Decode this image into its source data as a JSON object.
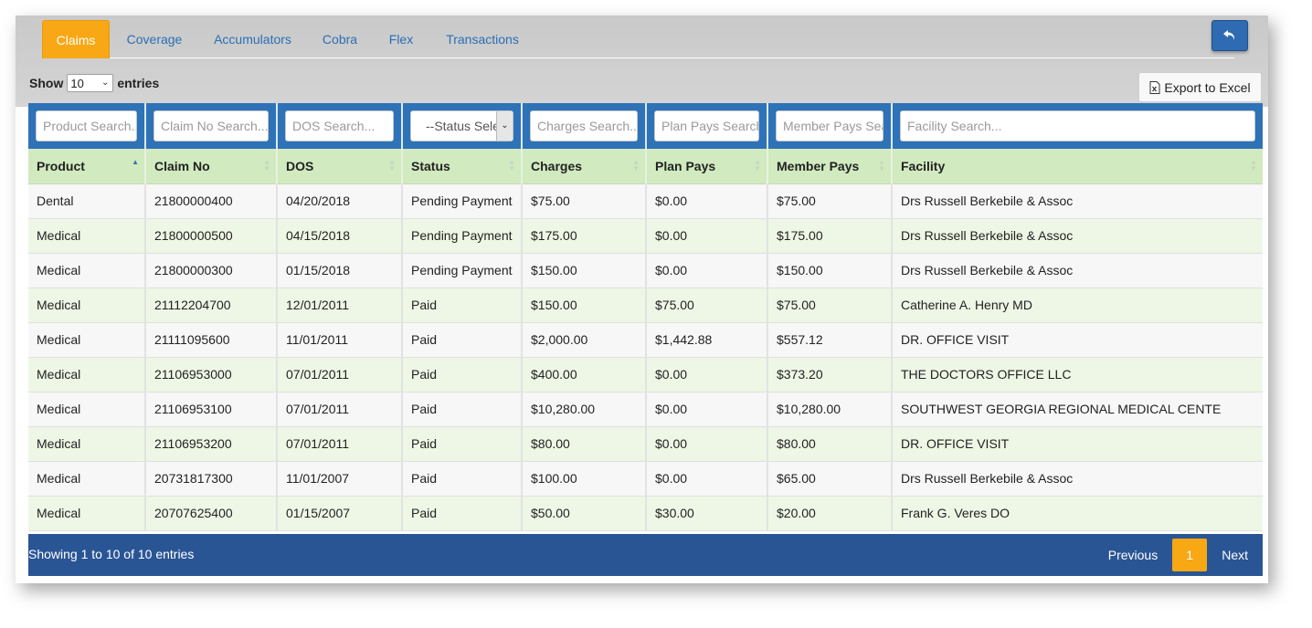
{
  "tabs": [
    {
      "label": "Claims",
      "active": true
    },
    {
      "label": "Coverage"
    },
    {
      "label": "Accumulators"
    },
    {
      "label": "Cobra"
    },
    {
      "label": "Flex"
    },
    {
      "label": "Transactions"
    }
  ],
  "back_button": {
    "icon": "undo-arrow-icon"
  },
  "length": {
    "show": "Show",
    "value": "10",
    "entries": "entries"
  },
  "export": {
    "label": "Export to Excel",
    "icon": "excel-file-icon"
  },
  "filters": {
    "product": "Product Search...",
    "claim_no": "Claim No Search...",
    "dos": "DOS Search...",
    "status": "--Status Select--",
    "charges": "Charges Search...",
    "plan_pays": "Plan Pays Search...",
    "member_pays": "Member Pays Search...",
    "facility": "Facility Search..."
  },
  "columns": [
    "Product",
    "Claim No",
    "DOS",
    "Status",
    "Charges",
    "Plan Pays",
    "Member Pays",
    "Facility"
  ],
  "rows": [
    [
      "Dental",
      "21800000400",
      "04/20/2018",
      "Pending Payment",
      "$75.00",
      "$0.00",
      "$75.00",
      "Drs Russell Berkebile & Assoc"
    ],
    [
      "Medical",
      "21800000500",
      "04/15/2018",
      "Pending Payment",
      "$175.00",
      "$0.00",
      "$175.00",
      "Drs Russell Berkebile & Assoc"
    ],
    [
      "Medical",
      "21800000300",
      "01/15/2018",
      "Pending Payment",
      "$150.00",
      "$0.00",
      "$150.00",
      "Drs Russell Berkebile & Assoc"
    ],
    [
      "Medical",
      "21112204700",
      "12/01/2011",
      "Paid",
      "$150.00",
      "$75.00",
      "$75.00",
      "Catherine A. Henry MD"
    ],
    [
      "Medical",
      "21111095600",
      "11/01/2011",
      "Paid",
      "$2,000.00",
      "$1,442.88",
      "$557.12",
      "DR. OFFICE VISIT"
    ],
    [
      "Medical",
      "21106953000",
      "07/01/2011",
      "Paid",
      "$400.00",
      "$0.00",
      "$373.20",
      "THE DOCTORS OFFICE LLC"
    ],
    [
      "Medical",
      "21106953100",
      "07/01/2011",
      "Paid",
      "$10,280.00",
      "$0.00",
      "$10,280.00",
      "SOUTHWEST GEORGIA REGIONAL MEDICAL CENTE"
    ],
    [
      "Medical",
      "21106953200",
      "07/01/2011",
      "Paid",
      "$80.00",
      "$0.00",
      "$80.00",
      "DR. OFFICE VISIT"
    ],
    [
      "Medical",
      "20731817300",
      "11/01/2007",
      "Paid",
      "$100.00",
      "$0.00",
      "$65.00",
      "Drs Russell Berkebile & Assoc"
    ],
    [
      "Medical",
      "20707625400",
      "01/15/2007",
      "Paid",
      "$50.00",
      "$30.00",
      "$20.00",
      "Frank G. Veres DO"
    ]
  ],
  "footer": {
    "info": "Showing 1 to 10 of 10 entries",
    "previous": "Previous",
    "page": "1",
    "next": "Next"
  },
  "colors": {
    "accent": "#f7a814",
    "primary": "#2e72b8",
    "footer": "#2a5595",
    "header_row": "#d1eac0"
  }
}
